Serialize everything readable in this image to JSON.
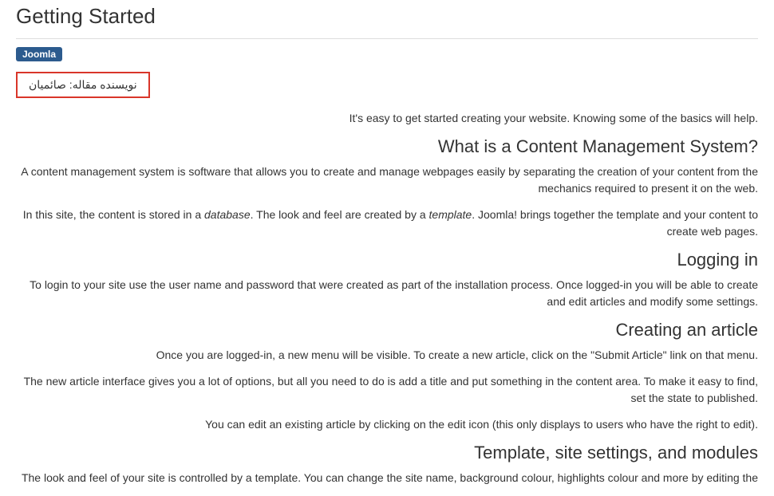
{
  "title": "Getting Started",
  "badge": "Joomla",
  "author_line": "نویسنده مقاله: صائمیان",
  "intro": "It's easy to get started creating your website. Knowing some of the basics will help.",
  "sections": {
    "cms": {
      "heading": "What is a Content Management System?",
      "p1": "A content management system is software that allows you to create and manage webpages easily by separating the creation of your content from the mechanics required to present it on the web.",
      "p2_pre": "In this site, the content is stored in a ",
      "p2_em1": "database",
      "p2_mid": ". The look and feel are created by a ",
      "p2_em2": "template",
      "p2_post": ". Joomla! brings together the template and your content to create web pages."
    },
    "login": {
      "heading": "Logging in",
      "p1": "To login to your site use the user name and password that were created as part of the installation process. Once logged-in you will be able to create and edit articles and modify some settings."
    },
    "article": {
      "heading": "Creating an article",
      "p1": "Once you are logged-in, a new menu will be visible. To create a new article, click on the \"Submit Article\" link on that menu.",
      "p2": "The new article interface gives you a lot of options, but all you need to do is add a title and put something in the content area. To make it easy to find, set the state to published.",
      "p3": "You can edit an existing article by clicking on the edit icon (this only displays to users who have the right to edit)."
    },
    "template": {
      "heading": "Template, site settings, and modules",
      "p1": "The look and feel of your site is controlled by a template. You can change the site name, background colour, highlights colour and more by editing the"
    }
  }
}
